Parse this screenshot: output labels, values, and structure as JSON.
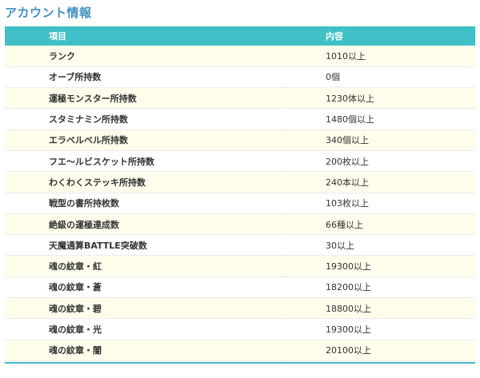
{
  "page": {
    "title": "アカウント情報"
  },
  "table": {
    "headers": {
      "item": "項目",
      "value": "内容"
    },
    "rows": [
      {
        "label": "ランク",
        "value": "1010以上"
      },
      {
        "label": "オーブ所持数",
        "value": "0個"
      },
      {
        "label": "運極モンスター所持数",
        "value": "1230体以上"
      },
      {
        "label": "スタミナミン所持数",
        "value": "1480個以上"
      },
      {
        "label": "エラベルベル所持数",
        "value": "340個以上"
      },
      {
        "label": "フエ〜ルビスケット所持数",
        "value": "200枚以上"
      },
      {
        "label": "わくわくステッキ所持数",
        "value": "240本以上"
      },
      {
        "label": "戦型の書所持枚数",
        "value": "103枚以上"
      },
      {
        "label": "絶級の運極達成数",
        "value": "66種以上"
      },
      {
        "label": "天魔通算BATTLE突破数",
        "value": "30以上"
      },
      {
        "label": "魂の紋章・紅",
        "value": "19300以上"
      },
      {
        "label": "魂の紋章・蒼",
        "value": "18200以上"
      },
      {
        "label": "魂の紋章・碧",
        "value": "18800以上"
      },
      {
        "label": "魂の紋章・光",
        "value": "19300以上"
      },
      {
        "label": "魂の紋章・闇",
        "value": "20100以上"
      }
    ]
  },
  "colors": {
    "title": "#3f8fc3",
    "header_bg": "#3fbfc6",
    "stripe_bg": "#fffdec"
  }
}
